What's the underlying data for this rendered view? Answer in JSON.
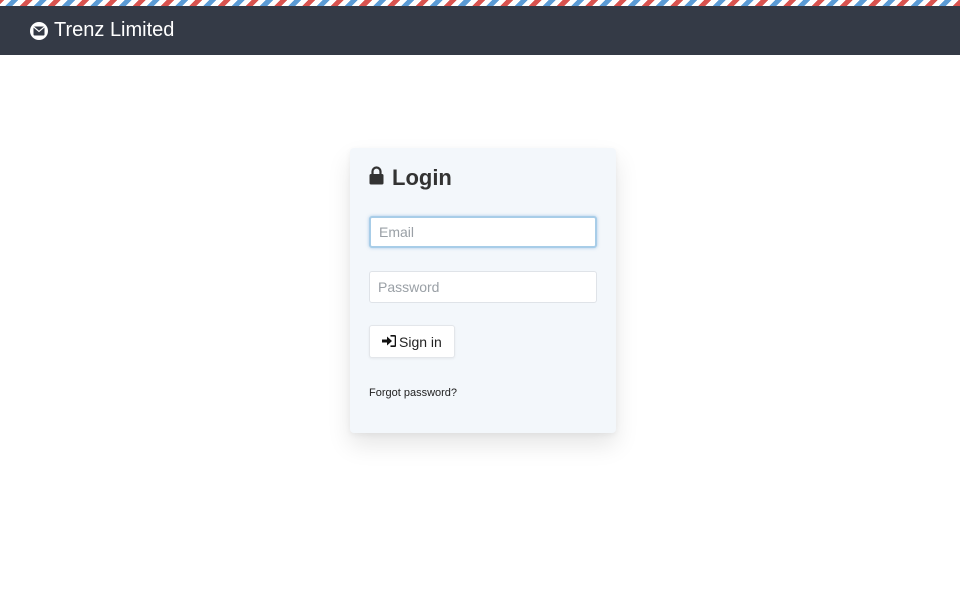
{
  "header": {
    "brand_name": "Trenz Limited",
    "brand_icon": "envelope-icon"
  },
  "login": {
    "title": "Login",
    "title_icon": "lock-icon",
    "email_placeholder": "Email",
    "email_value": "",
    "password_placeholder": "Password",
    "password_value": "",
    "submit_label": "Sign in",
    "submit_icon": "sign-in-icon",
    "forgot_link": "Forgot password?"
  },
  "colors": {
    "navbar": "#343a46",
    "stripe_red": "#d9534f",
    "stripe_blue": "#5b9bd5",
    "card_bg": "#f3f7fb",
    "focus_border": "#a8cde8"
  }
}
